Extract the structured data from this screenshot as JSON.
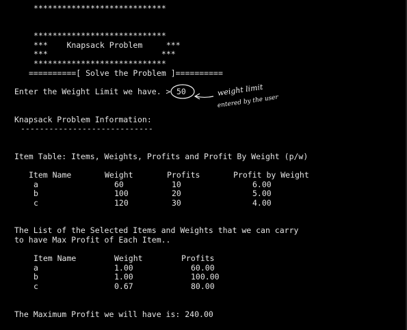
{
  "console": {
    "banner_top": "****************************",
    "banner_box_top": "****************************",
    "banner_title_line": "***    Knapsack Problem     ***",
    "banner_empty_line": "***                        ***",
    "banner_box_bottom": "****************************",
    "solve_line": "==========[ Solve the Problem ]==========",
    "weight_prompt": "Enter the Weight Limit we have. >",
    "weight_input_value": "50",
    "info_heading": "Knapsack Problem Information:",
    "info_underline": "----------------------------",
    "item_table_heading": "Item Table: Items, Weights, Profits and Profit By Weight (p/w)"
  },
  "annotation": {
    "line1": "weight limit",
    "line2": "entered by the user"
  },
  "item_table": {
    "headers": [
      "Item Name",
      "Weight",
      "Profits",
      "Profit by Weight"
    ],
    "rows": [
      [
        "a",
        "60",
        "10",
        "6.00"
      ],
      [
        "b",
        "100",
        "20",
        "5.00"
      ],
      [
        "c",
        "120",
        "30",
        "4.00"
      ]
    ]
  },
  "selected": {
    "heading_line1": "The List of the Selected Items and Weights that we can carry",
    "heading_line2": "to have Max Profit of Each Item..",
    "headers": [
      "Item Name",
      "Weight",
      "Profits"
    ],
    "rows": [
      [
        "a",
        "1.00",
        "60.00"
      ],
      [
        "b",
        "1.00",
        "100.00"
      ],
      [
        "c",
        "0.67",
        "80.00"
      ]
    ]
  },
  "result": {
    "max_profit_line": "The Maximum Profit we will have is: 240.00"
  }
}
